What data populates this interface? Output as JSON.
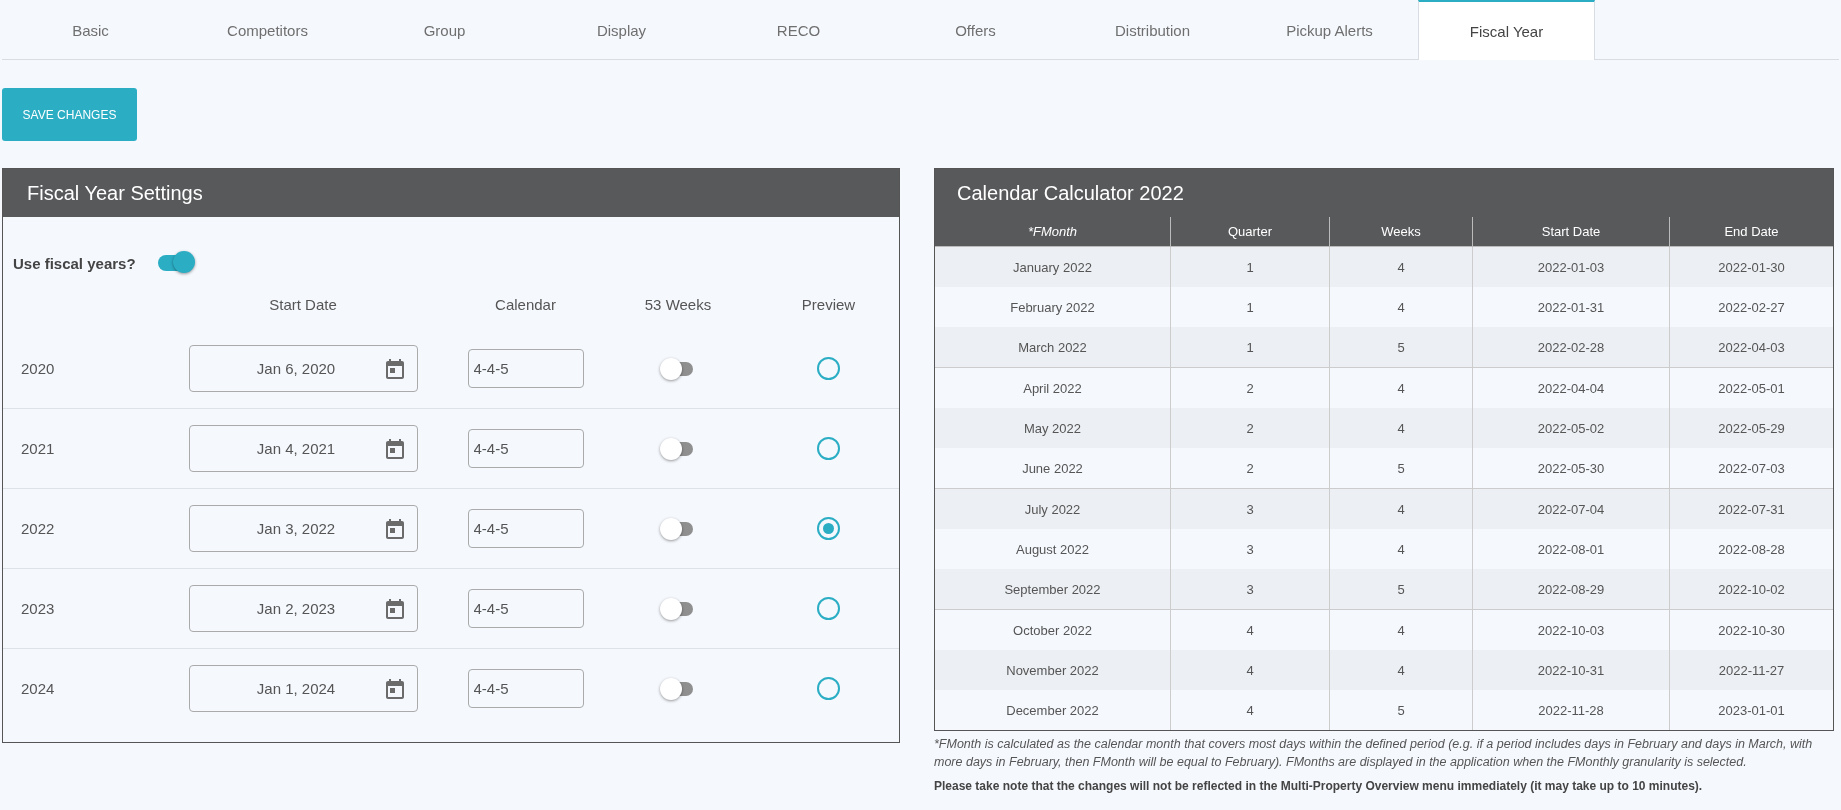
{
  "tabs": [
    {
      "label": "Basic",
      "selected": false
    },
    {
      "label": "Competitors",
      "selected": false
    },
    {
      "label": "Group",
      "selected": false
    },
    {
      "label": "Display",
      "selected": false
    },
    {
      "label": "RECO",
      "selected": false
    },
    {
      "label": "Offers",
      "selected": false
    },
    {
      "label": "Distribution",
      "selected": false
    },
    {
      "label": "Pickup Alerts",
      "selected": false
    },
    {
      "label": "Fiscal Year",
      "selected": true
    }
  ],
  "save_button": "SAVE CHANGES",
  "fiscal_settings": {
    "title": "Fiscal Year Settings",
    "use_fiscal_label": "Use fiscal years?",
    "use_fiscal_on": true,
    "columns": [
      "Start Date",
      "Calendar",
      "53 Weeks",
      "Preview"
    ],
    "years": [
      {
        "year": "2020",
        "start_date": "Jan 6, 2020",
        "calendar": "4-4-5",
        "weeks_53": false,
        "selected": false
      },
      {
        "year": "2021",
        "start_date": "Jan 4, 2021",
        "calendar": "4-4-5",
        "weeks_53": false,
        "selected": false
      },
      {
        "year": "2022",
        "start_date": "Jan 3, 2022",
        "calendar": "4-4-5",
        "weeks_53": false,
        "selected": true
      },
      {
        "year": "2023",
        "start_date": "Jan 2, 2023",
        "calendar": "4-4-5",
        "weeks_53": false,
        "selected": false
      },
      {
        "year": "2024",
        "start_date": "Jan 1, 2024",
        "calendar": "4-4-5",
        "weeks_53": false,
        "selected": false
      }
    ]
  },
  "calculator": {
    "title": "Calendar Calculator 2022",
    "columns": [
      "*FMonth",
      "Quarter",
      "Weeks",
      "Start Date",
      "End Date"
    ],
    "rows": [
      [
        "January 2022",
        "1",
        "4",
        "2022-01-03",
        "2022-01-30"
      ],
      [
        "February 2022",
        "1",
        "4",
        "2022-01-31",
        "2022-02-27"
      ],
      [
        "March 2022",
        "1",
        "5",
        "2022-02-28",
        "2022-04-03"
      ],
      [
        "April 2022",
        "2",
        "4",
        "2022-04-04",
        "2022-05-01"
      ],
      [
        "May 2022",
        "2",
        "4",
        "2022-05-02",
        "2022-05-29"
      ],
      [
        "June 2022",
        "2",
        "5",
        "2022-05-30",
        "2022-07-03"
      ],
      [
        "July 2022",
        "3",
        "4",
        "2022-07-04",
        "2022-07-31"
      ],
      [
        "August 2022",
        "3",
        "4",
        "2022-08-01",
        "2022-08-28"
      ],
      [
        "September 2022",
        "3",
        "5",
        "2022-08-29",
        "2022-10-02"
      ],
      [
        "October 2022",
        "4",
        "4",
        "2022-10-03",
        "2022-10-30"
      ],
      [
        "November 2022",
        "4",
        "4",
        "2022-10-31",
        "2022-11-27"
      ],
      [
        "December 2022",
        "4",
        "5",
        "2022-11-28",
        "2023-01-01"
      ]
    ],
    "footnote": "*FMonth is calculated as the calendar month that covers most days within the defined period (e.g. if a period includes days in February and days in March, with more days in February, then FMonth will be equal to February). FMonths are displayed in the application when the FMonthly granularity is selected.",
    "notice": "Please take note that the changes will not be reflected in the Multi-Property Overview menu immediately (it may take up to 10 minutes)."
  }
}
